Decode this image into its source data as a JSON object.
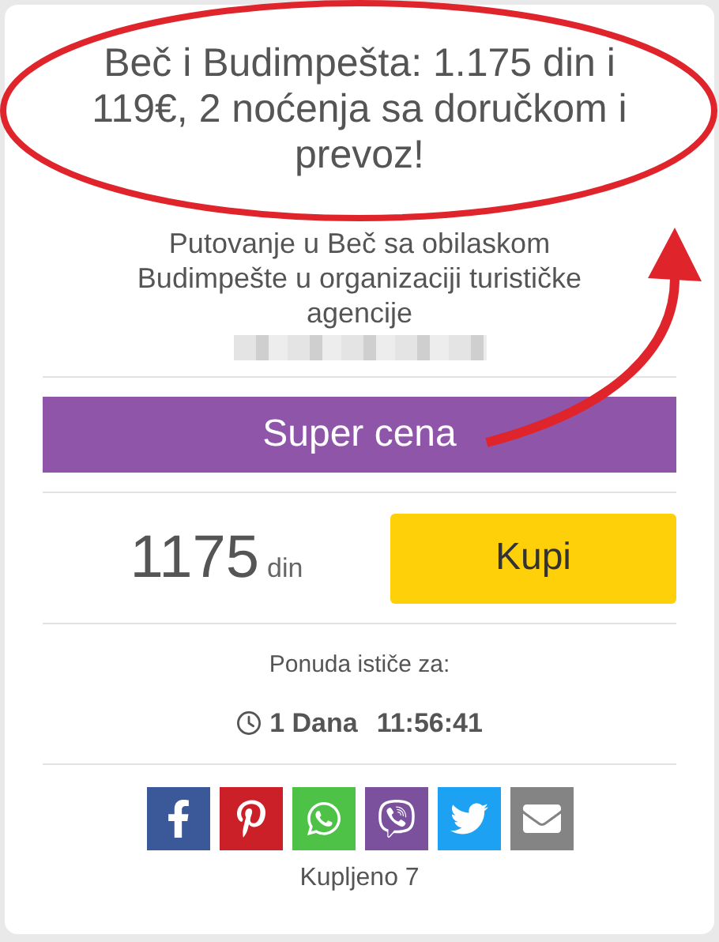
{
  "offer": {
    "title": "Beč i Budimpešta: 1.175 din i 119€, 2 noćenja sa doručkom i prevoz!",
    "description": "Putovanje u Beč sa obilaskom Budimpešte u organizaciji turističke agencije",
    "badge": "Super cena",
    "price": "1175",
    "currency": "din",
    "buy_button": "Kupi",
    "expires_label": "Ponuda ističe za:",
    "countdown_days": "1 Dana",
    "countdown_time": "11:56:41",
    "share_buttons": [
      {
        "kind": "facebook",
        "color": "#3b5998"
      },
      {
        "kind": "pinterest",
        "color": "#cb2027"
      },
      {
        "kind": "whatsapp",
        "color": "#4dc247"
      },
      {
        "kind": "viber",
        "color": "#7b519d"
      },
      {
        "kind": "twitter",
        "color": "#1da1f2"
      },
      {
        "kind": "email",
        "color": "#848484"
      }
    ],
    "purchased": "Kupljeno 7"
  }
}
